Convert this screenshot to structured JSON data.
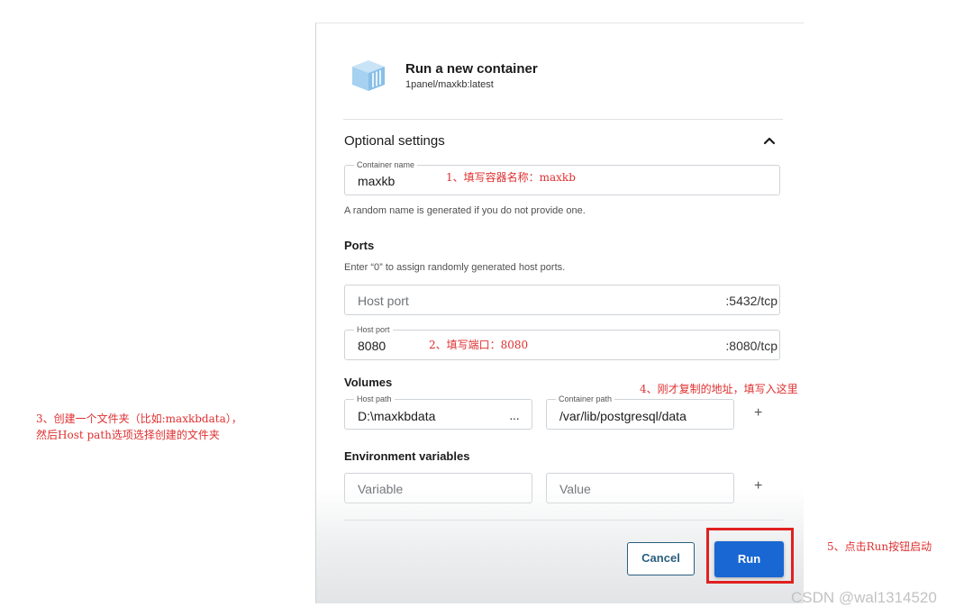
{
  "dialog": {
    "title": "Run a new container",
    "image": "1panel/maxkb:latest",
    "logo_icon": "container-box-icon",
    "optional_settings": {
      "title": "Optional settings",
      "toggle_icon": "chevron-up-icon",
      "container_name": {
        "label": "Container name",
        "value": "maxkb",
        "hint": "A random name is generated if you do not provide one."
      },
      "ports": {
        "title": "Ports",
        "hint": "Enter “0” to assign randomly generated host ports.",
        "rows": [
          {
            "label": "",
            "placeholder": "Host port",
            "value": "",
            "container_port": ":5432/tcp"
          },
          {
            "label": "Host port",
            "placeholder": "",
            "value": "8080",
            "container_port": ":8080/tcp"
          }
        ]
      },
      "volumes": {
        "title": "Volumes",
        "host_path_label": "Host path",
        "host_path_value": "D:\\maxkbdata",
        "browse_label": "···",
        "container_path_label": "Container path",
        "container_path_value": "/var/lib/postgresql/data",
        "add_label": "+"
      },
      "env": {
        "title": "Environment variables",
        "variable_placeholder": "Variable",
        "value_placeholder": "Value",
        "add_label": "+"
      }
    },
    "buttons": {
      "cancel": "Cancel",
      "run": "Run"
    }
  },
  "annotations": {
    "a1": "1、填写容器名称：maxkb",
    "a2": "2、填写端口：8080",
    "a3_line1": "3、创建一个文件夹（比如:maxkbdata），",
    "a3_line2": "然后Host path选项选择创建的文件夹",
    "a4": "4、刚才复制的地址，填写入这里",
    "a5": "5、点击Run按钮启动",
    "highlight_color": "#e02020"
  },
  "watermark": "CSDN @wal1314520",
  "colors": {
    "primary": "#1967d2",
    "cancel_border": "#2a5f7f",
    "annotation": "#e03030"
  }
}
